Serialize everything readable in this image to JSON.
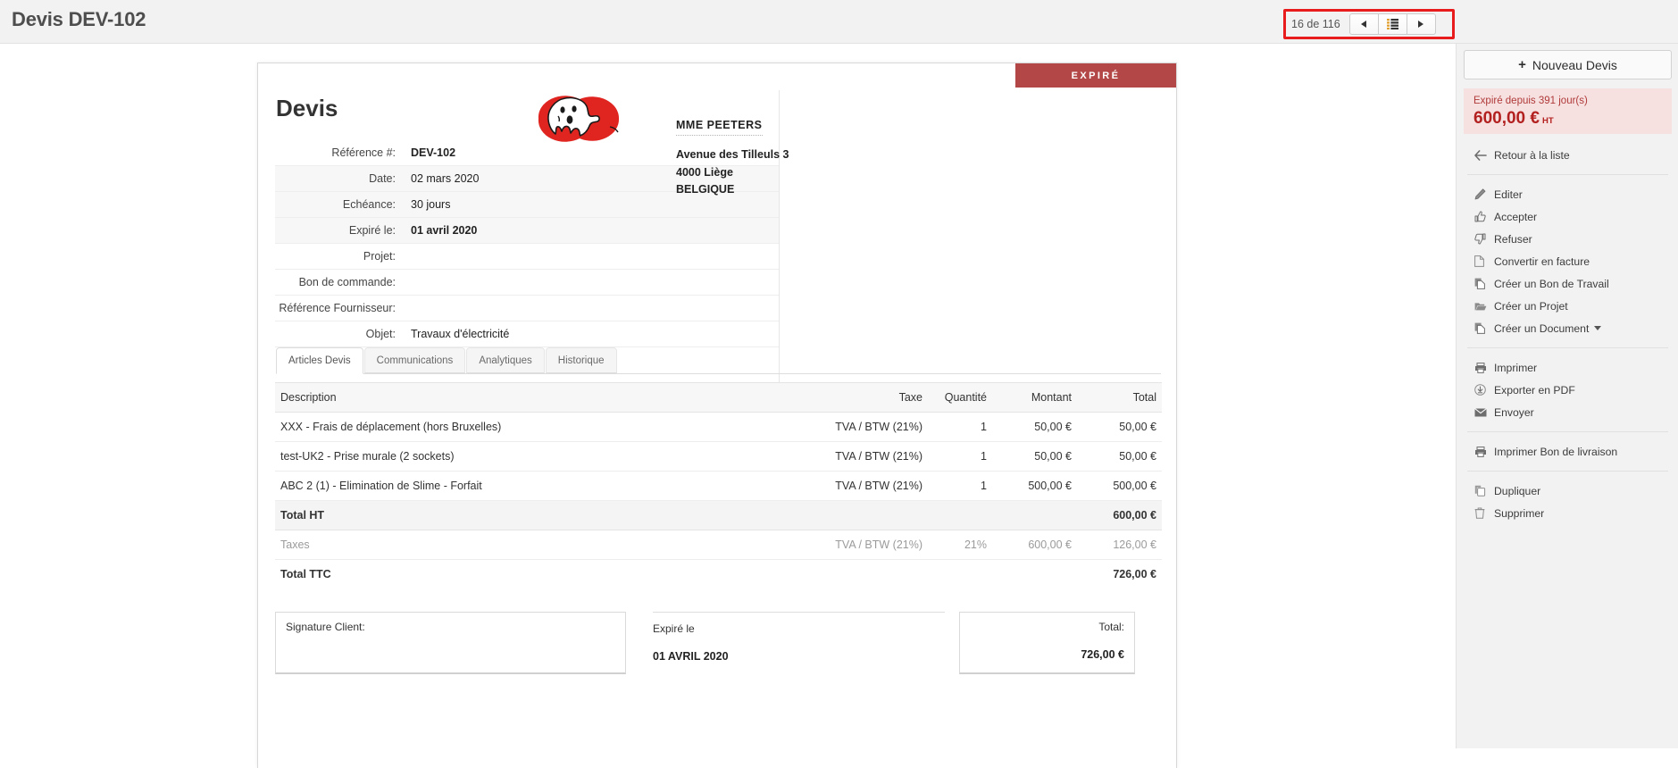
{
  "header": {
    "title": "Devis DEV-102",
    "pager": {
      "count_label": "16 de 116",
      "prev_icon": "triangle-left-icon",
      "list_icon": "list-icon",
      "next_icon": "triangle-right-icon"
    }
  },
  "document": {
    "status_badge": "EXPIRÉ",
    "heading": "Devis",
    "logo_name": "ghostbusters-logo",
    "fields": [
      {
        "label": "Référence #:",
        "value": "DEV-102",
        "bold": true,
        "shaded": false
      },
      {
        "label": "Date:",
        "value": "02 mars 2020",
        "bold": false,
        "shaded": true
      },
      {
        "label": "Echéance:",
        "value": "30 jours",
        "bold": false,
        "shaded": true
      },
      {
        "label": "Expiré le:",
        "value": "01 avril 2020",
        "bold": true,
        "shaded": true
      },
      {
        "label": "Projet:",
        "value": "",
        "bold": false,
        "shaded": false
      },
      {
        "label": "Bon de commande:",
        "value": "",
        "bold": false,
        "shaded": false
      },
      {
        "label": "Référence Fournisseur:",
        "value": "",
        "bold": false,
        "shaded": false
      },
      {
        "label": "Objet:",
        "value": "Travaux d'électricité",
        "bold": false,
        "shaded": false
      }
    ],
    "customer": {
      "name": "MME PEETERS",
      "address_line1": "Avenue des Tilleuls 3",
      "address_line2": "4000 Liège",
      "address_line3": "BELGIQUE"
    },
    "tabs": [
      {
        "label": "Articles Devis",
        "active": true
      },
      {
        "label": "Communications",
        "active": false
      },
      {
        "label": "Analytiques",
        "active": false
      },
      {
        "label": "Historique",
        "active": false
      }
    ],
    "items_table": {
      "columns": [
        "Description",
        "Taxe",
        "Quantité",
        "Montant",
        "Total"
      ],
      "rows": [
        {
          "description": "XXX - Frais de déplacement (hors Bruxelles)",
          "taxe": "TVA / BTW (21%)",
          "quantite": "1",
          "montant": "50,00 €",
          "total": "50,00 €"
        },
        {
          "description": "test-UK2 - Prise murale (2 sockets)",
          "taxe": "TVA / BTW (21%)",
          "quantite": "1",
          "montant": "50,00 €",
          "total": "50,00 €"
        },
        {
          "description": "ABC 2 (1) - Elimination de Slime - Forfait",
          "taxe": "TVA / BTW (21%)",
          "quantite": "1",
          "montant": "500,00 €",
          "total": "500,00 €"
        }
      ],
      "summary": {
        "total_ht_label": "Total HT",
        "total_ht_value": "600,00 €",
        "taxes_label": "Taxes",
        "taxes_taxe": "TVA / BTW (21%)",
        "taxes_rate": "21%",
        "taxes_base": "600,00 €",
        "taxes_value": "126,00 €",
        "total_ttc_label": "Total TTC",
        "total_ttc_value": "726,00 €"
      }
    },
    "footer": {
      "signature_label": "Signature Client:",
      "expiry_label": "Expiré le",
      "expiry_value": "01 AVRIL 2020",
      "total_label": "Total:",
      "total_value": "726,00 €"
    }
  },
  "sidebar": {
    "new_button": {
      "label": "Nouveau Devis",
      "plus": "+"
    },
    "amount_box": {
      "subtitle": "Expiré depuis 391 jour(s)",
      "amount": "600,00 €",
      "suffix": "HT",
      "accent_color": "#b32020",
      "background_color": "#f7e0e0"
    },
    "back_item": {
      "label": "Retour à la liste",
      "icon": "arrow-left-icon"
    },
    "group1": [
      {
        "label": "Editer",
        "icon": "pencil-icon"
      },
      {
        "label": "Accepter",
        "icon": "thumbs-up-icon"
      },
      {
        "label": "Refuser",
        "icon": "thumbs-down-icon"
      },
      {
        "label": "Convertir en facture",
        "icon": "file-icon"
      },
      {
        "label": "Créer un Bon de Travail",
        "icon": "copy-icon"
      },
      {
        "label": "Créer un Projet",
        "icon": "folder-open-icon"
      },
      {
        "label": "Créer un Document",
        "icon": "copy-icon",
        "caret": true
      }
    ],
    "group2": [
      {
        "label": "Imprimer",
        "icon": "printer-icon"
      },
      {
        "label": "Exporter en PDF",
        "icon": "download-circle-icon"
      },
      {
        "label": "Envoyer",
        "icon": "envelope-icon"
      }
    ],
    "group3": [
      {
        "label": "Imprimer Bon de livraison",
        "icon": "printer-icon"
      }
    ],
    "group4": [
      {
        "label": "Dupliquer",
        "icon": "duplicate-icon"
      },
      {
        "label": "Supprimer",
        "icon": "trash-icon"
      }
    ]
  }
}
